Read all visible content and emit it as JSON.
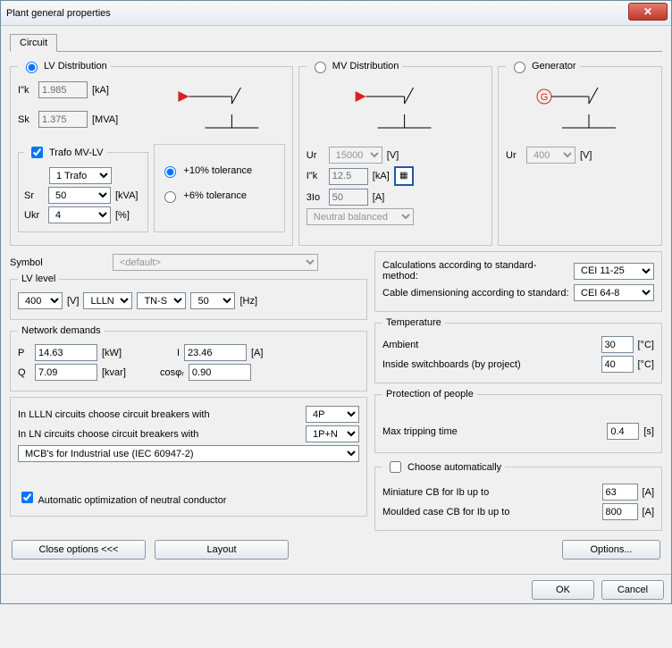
{
  "window": {
    "title": "Plant general properties"
  },
  "tab": {
    "circuit": "Circuit"
  },
  "lvdist": {
    "legend": "LV Distribution",
    "ik_lbl": "I\"k",
    "ik_val": "1.985",
    "ik_unit": "[kA]",
    "sk_lbl": "Sk",
    "sk_val": "1.375",
    "sk_unit": "[MVA]",
    "trafo_chk": "Trafo MV-LV",
    "trafo_sel": "1 Trafo",
    "sr_lbl": "Sr",
    "sr_val": "50",
    "sr_unit": "[kVA]",
    "ukr_lbl": "Ukr",
    "ukr_val": "4",
    "ukr_unit": "[%]",
    "tol10": "+10% tolerance",
    "tol6": "+6% tolerance"
  },
  "mvdist": {
    "legend": "MV Distribution",
    "ur_lbl": "Ur",
    "ur_val": "15000",
    "ur_unit": "[V]",
    "ik_lbl": "I\"k",
    "ik_val": "12.5",
    "ik_unit": "[kA]",
    "io_lbl": "3Io",
    "io_val": "50",
    "io_unit": "[A]",
    "neutral": "Neutral balanced"
  },
  "gen": {
    "legend": "Generator",
    "ur_lbl": "Ur",
    "ur_val": "400",
    "ur_unit": "[V]"
  },
  "symbol": {
    "lbl": "Symbol",
    "val": "<default>"
  },
  "lvlevel": {
    "legend": "LV level",
    "volt": "400",
    "volt_u": "[V]",
    "phase": "LLLN",
    "earth": "TN-S",
    "freq": "50",
    "freq_u": "[Hz]"
  },
  "netdem": {
    "legend": "Network demands",
    "p_lbl": "P",
    "p_val": "14.63",
    "p_unit": "[kW]",
    "i_lbl": "I",
    "i_val": "23.46",
    "i_unit": "[A]",
    "q_lbl": "Q",
    "q_val": "7.09",
    "q_unit": "[kvar]",
    "cos_lbl": "cosφᵣ",
    "cos_val": "0.90"
  },
  "breakers": {
    "lllnlabel": "In LLLN circuits choose circuit breakers with",
    "llln_val": "4P",
    "lnlabel": "In LN circuits choose circuit breakers with",
    "ln_val": "1P+N",
    "mcb": "MCB's for Industrial use (IEC 60947-2)",
    "autoopt": "Automatic optimization of neutral conductor"
  },
  "calc": {
    "method_lbl": "Calculations according to standard-method:",
    "method_val": "CEI 11-25",
    "cable_lbl": "Cable dimensioning according to standard:",
    "cable_val": "CEI 64-8"
  },
  "temp": {
    "legend": "Temperature",
    "amb_lbl": "Ambient",
    "amb_val": "30",
    "amb_unit": "[°C]",
    "swb_lbl": "Inside switchboards (by project)",
    "swb_val": "40",
    "swb_unit": "[°C]"
  },
  "prot": {
    "legend": "Protection of people",
    "trip_lbl": "Max tripping time",
    "trip_val": "0.4",
    "trip_unit": "[s]"
  },
  "auto": {
    "chk": "Choose automatically",
    "mini_lbl": "Miniature CB for Ib up to",
    "mini_val": "63",
    "mini_unit": "[A]",
    "mould_lbl": "Moulded case CB for Ib up to",
    "mould_val": "800",
    "mould_unit": "[A]"
  },
  "btns": {
    "close": "Close options <<<",
    "layout": "Layout",
    "options": "Options...",
    "ok": "OK",
    "cancel": "Cancel"
  }
}
